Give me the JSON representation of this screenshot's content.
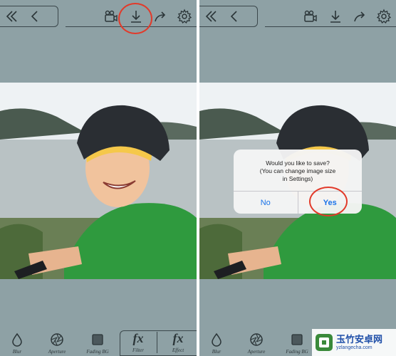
{
  "toolbar": {
    "icons": [
      "double-chevron-left-icon",
      "chevron-left-icon",
      "video-camera-icon",
      "download-icon",
      "share-icon",
      "gear-icon"
    ]
  },
  "bottom_bar": {
    "items": [
      {
        "icon": "droplet-icon",
        "label": "Blur"
      },
      {
        "icon": "aperture-icon",
        "label": "Aperture"
      },
      {
        "icon": "square-icon",
        "label": "Fading BG"
      },
      {
        "icon": "fx-icon",
        "glyph": "fx",
        "label": "Filter"
      },
      {
        "icon": "fx-icon",
        "glyph": "fx",
        "label": "Effect"
      }
    ]
  },
  "dialog": {
    "message_lines": [
      "Would you like to save?",
      "(You can change image size",
      "in Settings)"
    ],
    "no_label": "No",
    "yes_label": "Yes"
  },
  "watermark": {
    "title": "玉竹安卓网",
    "url": "yzlangecha.com"
  },
  "colors": {
    "background": "#8ea1a5",
    "icon": "#2b3538",
    "annotation": "#e23a2a",
    "dialog_button": "#1a73e8"
  }
}
